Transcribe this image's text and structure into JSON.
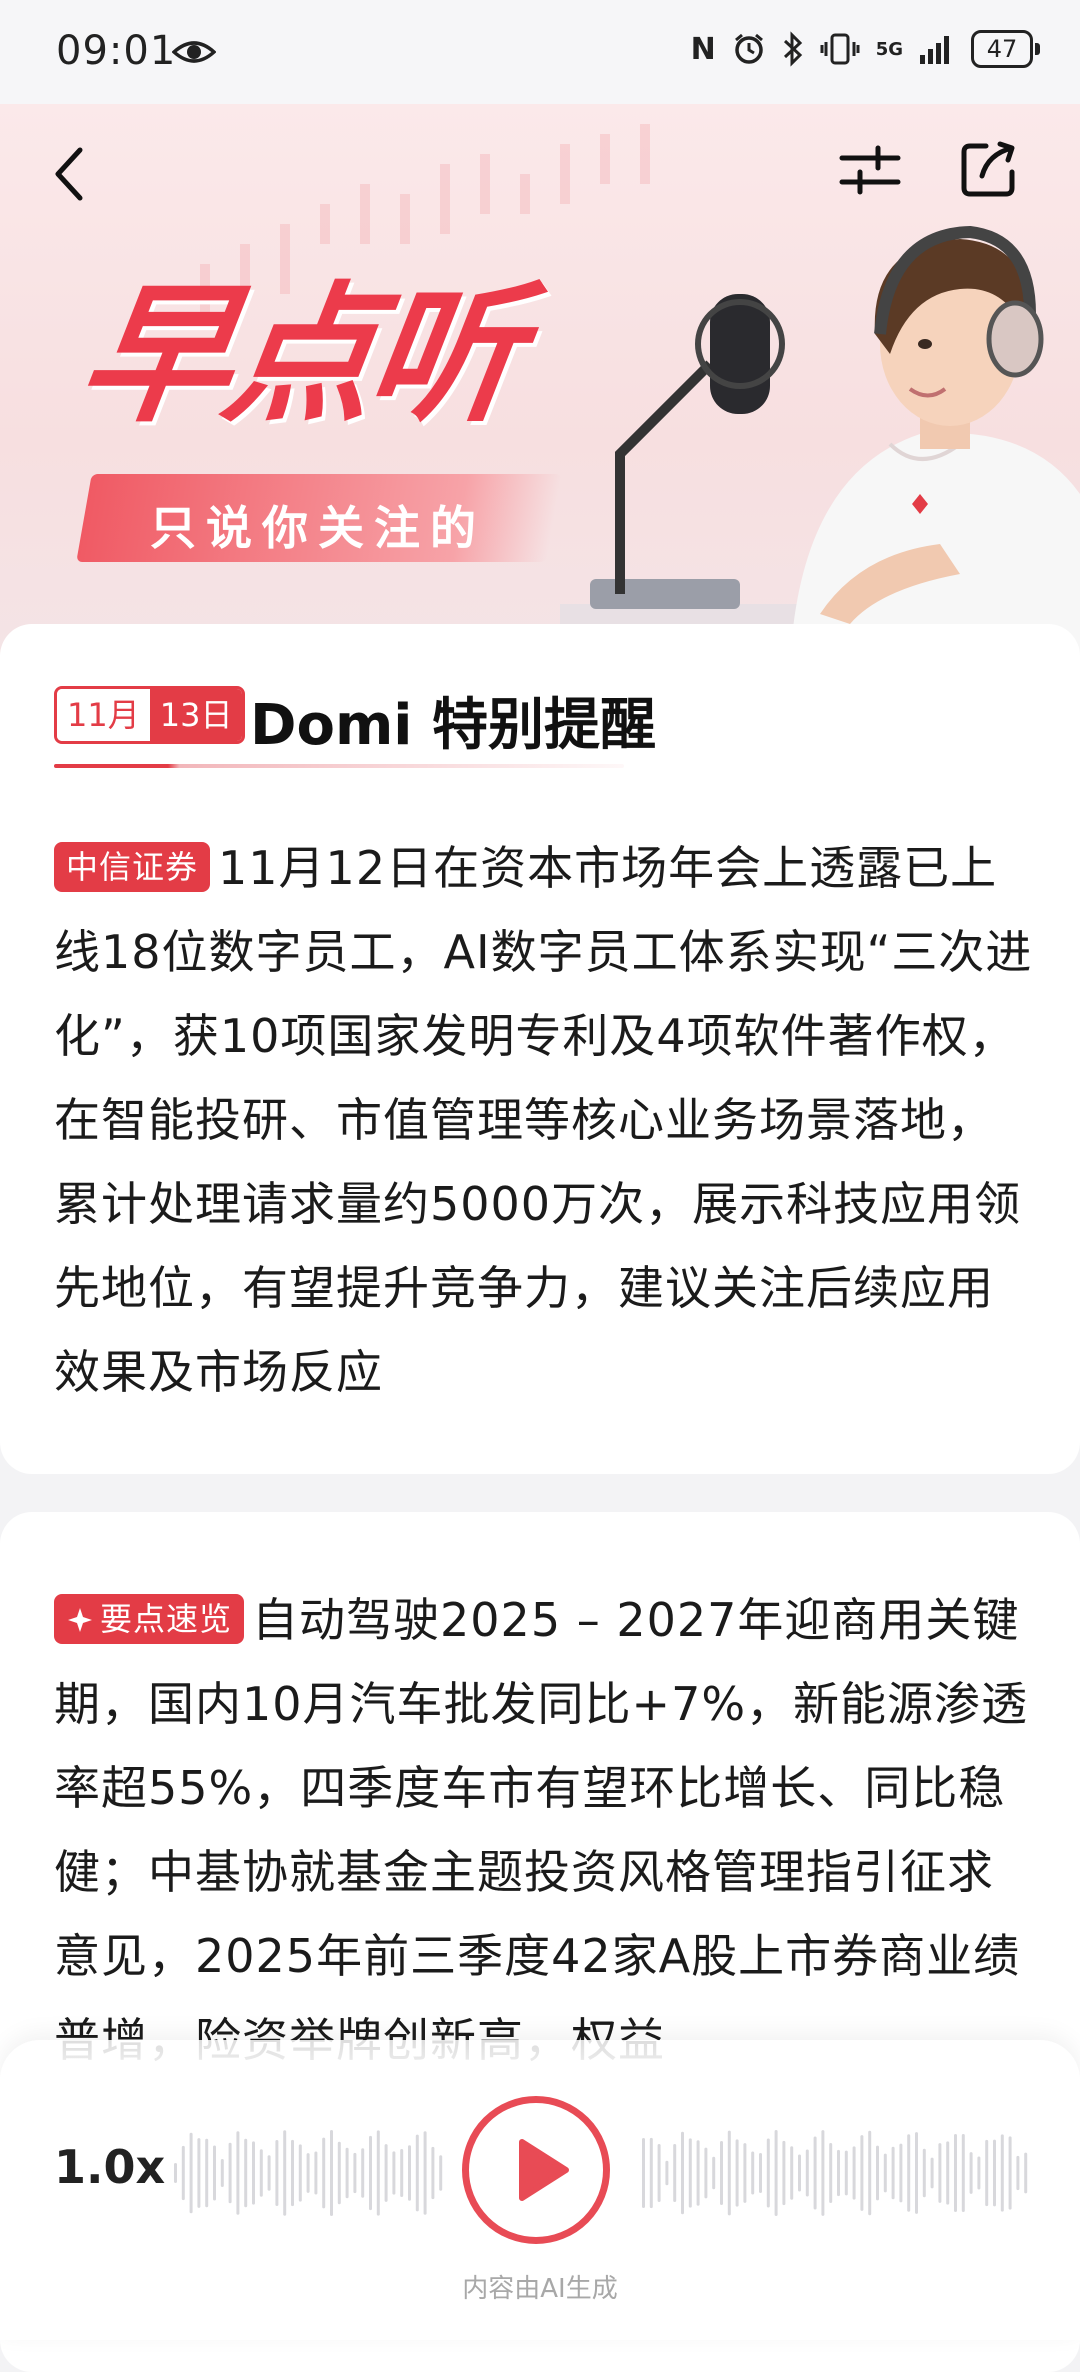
{
  "status_bar": {
    "time": "09:01",
    "network": "5G",
    "battery": "47",
    "icons": [
      "eye-icon",
      "nfc-icon",
      "alarm-icon",
      "bluetooth-icon",
      "vibrate-icon",
      "signal-icon",
      "battery-icon"
    ]
  },
  "banner": {
    "title": "早点听",
    "subtitle": "只说你关注的",
    "icons": [
      "back-icon",
      "filter-icon",
      "share-icon"
    ]
  },
  "header": {
    "date_month": "11月",
    "date_day": "13日",
    "title": "Domi 特别提醒"
  },
  "items": [
    {
      "tag": "中信证券",
      "text": "11月12日在资本市场年会上透露已上线18位数字员工，AI数字员工体系实现“三次进化”，获10项国家发明专利及4项软件著作权，在智能投研、市值管理等核心业务场景落地，累计处理请求量约5000万次，展示科技应用领先地位，有望提升竞争力，建议关注后续应用效果及市场反应"
    },
    {
      "tag": "要点速览",
      "text": "自动驾驶2025 – 2027年迎商用关键期，国内10月汽车批发同比+7%，新能源渗透率超55%，四季度车市有望环比增长、同比稳健；中基协就基金主题投资风格管理指引征求意见，2025年前三季度42家A股上市券商业绩普增，险资举牌创新高，权益"
    }
  ],
  "player": {
    "speed": "1.0x",
    "note": "内容由AI生成"
  },
  "colors": {
    "accent": "#e33c46",
    "banner_bg": "#fbe9ea"
  }
}
